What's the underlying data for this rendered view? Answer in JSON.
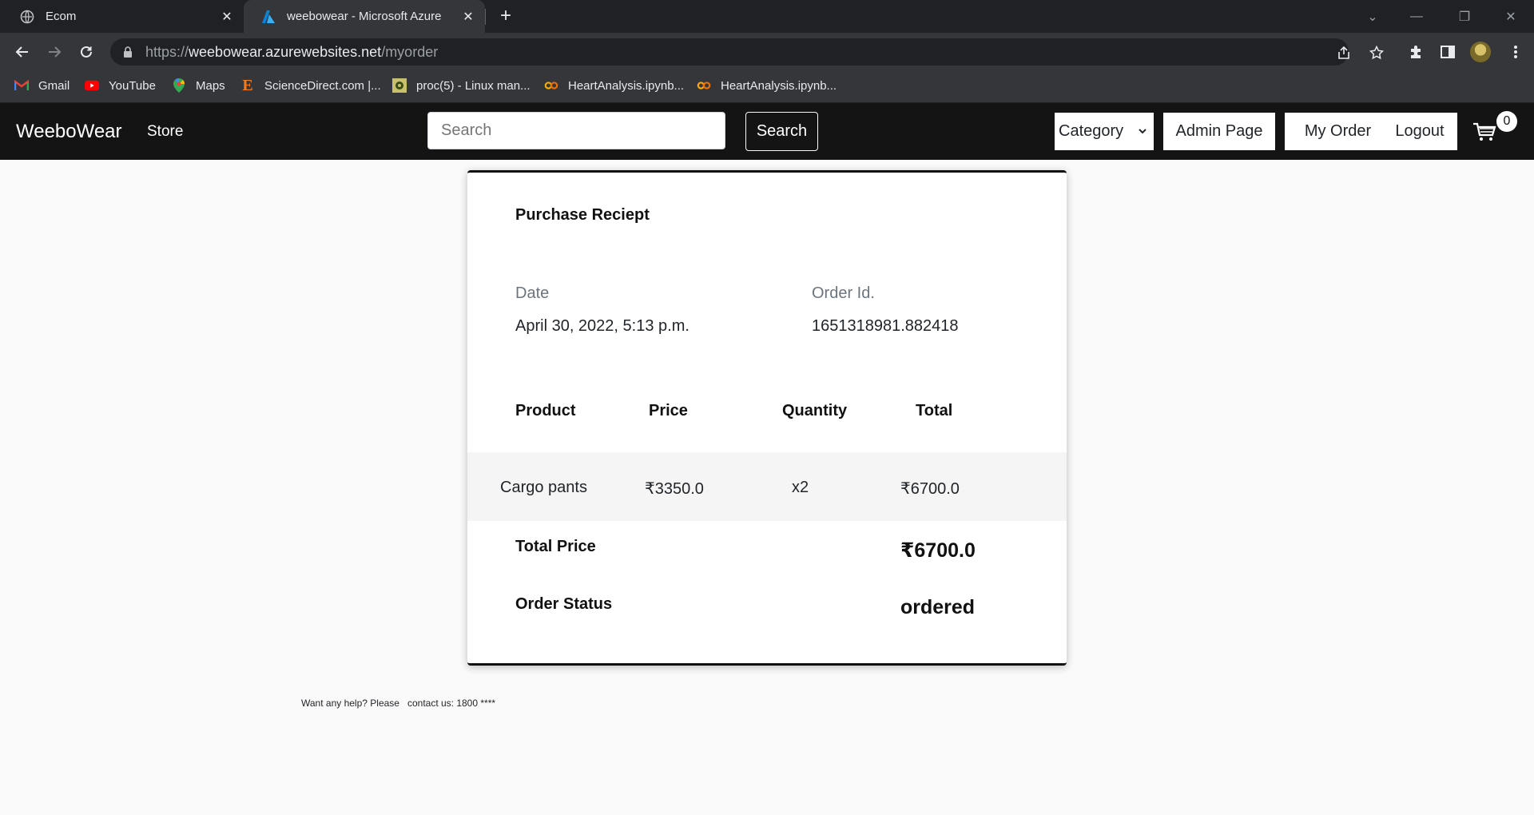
{
  "browser": {
    "tabs": [
      {
        "title": "Ecom",
        "icon": "globe-icon"
      },
      {
        "title": "weebowear - Microsoft Azure",
        "icon": "azure-icon"
      }
    ],
    "url_scheme": "https://",
    "url_host": "weebowear.azurewebsites.net",
    "url_path": "/myorder",
    "bookmarks": [
      {
        "label": "Gmail",
        "icon": "gmail-icon"
      },
      {
        "label": "YouTube",
        "icon": "youtube-icon"
      },
      {
        "label": "Maps",
        "icon": "maps-icon"
      },
      {
        "label": "ScienceDirect.com |...",
        "icon": "sciencedirect-icon"
      },
      {
        "label": "proc(5) - Linux man...",
        "icon": "linux-icon"
      },
      {
        "label": "HeartAnalysis.ipynb...",
        "icon": "colab-icon"
      },
      {
        "label": "HeartAnalysis.ipynb...",
        "icon": "colab-icon"
      }
    ]
  },
  "site": {
    "brand": "WeeboWear",
    "store_link": "Store",
    "search_placeholder": "Search",
    "search_button": "Search",
    "category_select": "Category",
    "admin_button": "Admin Page",
    "myorder_button": "My Order",
    "logout_button": "Logout",
    "cart_count": "0"
  },
  "receipt": {
    "title": "Purchase Reciept",
    "date_label": "Date",
    "date_value": "April 30, 2022, 5:13 p.m.",
    "order_id_label": "Order Id.",
    "order_id_value": "1651318981.882418",
    "columns": [
      "Product",
      "Price",
      "Quantity",
      "Total"
    ],
    "items": [
      {
        "product": "Cargo pants",
        "price": "₹3350.0",
        "quantity": "x2",
        "total": "₹6700.0"
      }
    ],
    "total_price_label": "Total Price",
    "total_price_value": "₹6700.0",
    "order_status_label": "Order Status",
    "order_status_value": "ordered"
  },
  "footer": {
    "help_text": "Want any help? Please   contact us: 1800 ****"
  },
  "colors": {
    "navbar_bg": "#141414",
    "chrome_tabstrip": "#202124",
    "chrome_toolbar": "#35363a",
    "youtube_red": "#ff0000",
    "colab_orange": "#f9ab00"
  }
}
